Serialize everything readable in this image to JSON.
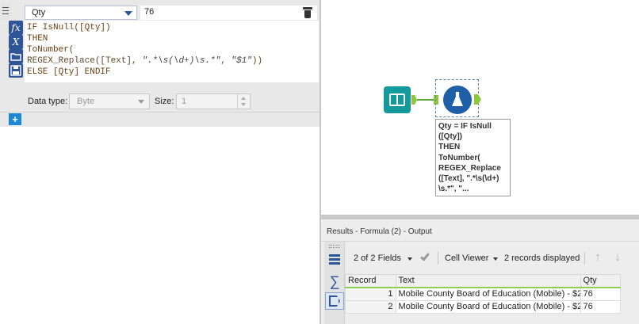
{
  "config": {
    "field_name": "Qty",
    "value_preview": "76",
    "expression_lines": {
      "l1_kw": "IF IsNull([Qty])",
      "l2_kw": "THEN",
      "l3_kw": "ToNumber(",
      "l4_fn": "REGEX_Replace([Text], ",
      "l4_str1": "\".*\\s(\\d+)\\s.*\"",
      "l4_mid": ", ",
      "l4_str2": "\"$1\"",
      "l4_end": "))",
      "l5_kw": "ELSE [Qty] ENDIF"
    },
    "data_type_label": "Data type:",
    "data_type_value": "Byte",
    "size_label": "Size:",
    "size_value": "1",
    "icons": {
      "formula": "fx",
      "variable": "X"
    },
    "add_label": "+"
  },
  "canvas": {
    "annotation_lines": [
      "Qty = IF IsNull",
      "([Qty])",
      "THEN",
      "ToNumber(",
      "REGEX_Replace",
      "([Text], \".*\\s(\\d+)",
      "\\s.*\", \"..."
    ]
  },
  "results": {
    "title": "Results - Formula (2) - Output",
    "fields_label": "2 of 2 Fields",
    "viewer_label": "Cell Viewer",
    "records_label": "2 records displayed",
    "arrow_up": "↑",
    "arrow_down": "↓",
    "sigma": "∑",
    "columns": [
      "Record",
      "Text",
      "Qty"
    ],
    "rows": [
      {
        "record": "1",
        "text": "Mobile County Board of Education (Mobile) - $2...",
        "qty": "76"
      },
      {
        "record": "2",
        "text": "Mobile County Board of Education (Mobile) - $2...",
        "qty": "76"
      }
    ]
  }
}
